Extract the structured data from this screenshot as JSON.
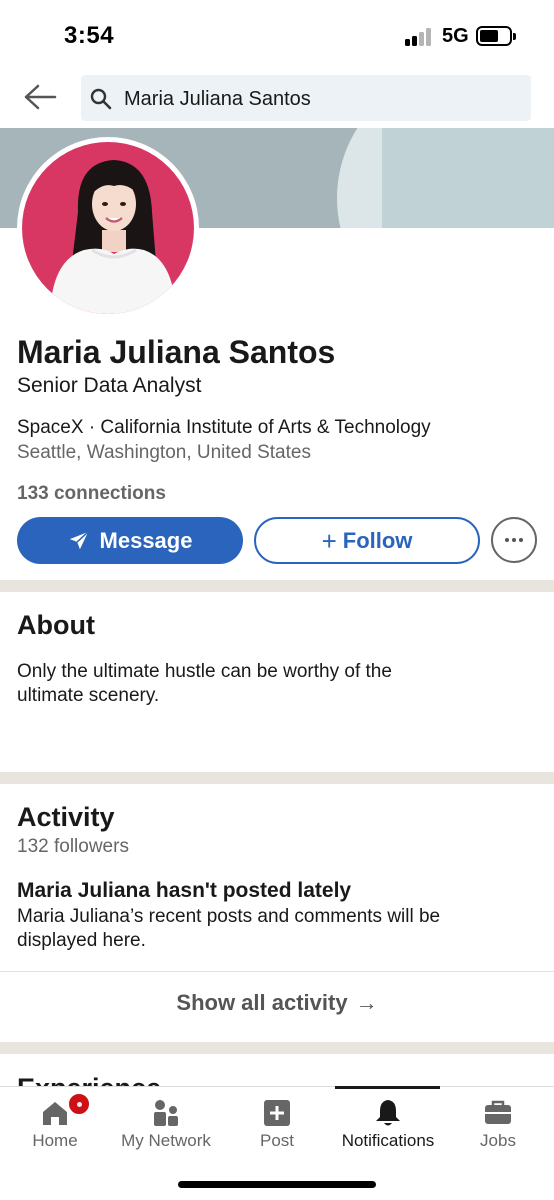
{
  "status_bar": {
    "time": "3:54",
    "network": "5G"
  },
  "search": {
    "query": "Maria Juliana Santos"
  },
  "profile": {
    "name": "Maria Juliana Santos",
    "headline": "Senior Data Analyst",
    "organizations": "SpaceX · California Institute of Arts & Technology",
    "location": "Seattle, Washington, United States",
    "connections": "133 connections",
    "message_label": "Message",
    "follow_label": "Follow",
    "follow_plus": "+"
  },
  "about": {
    "title": "About",
    "text": "Only the ultimate hustle can be worthy of the ultimate scenery."
  },
  "activity": {
    "title": "Activity",
    "followers": "132 followers",
    "heading": "Maria Juliana hasn't posted lately",
    "description": "Maria Juliana’s recent posts and comments will be displayed here.",
    "show_all": "Show all activity",
    "arrow": "→"
  },
  "experience": {
    "title": "Experience"
  },
  "bottom_nav": {
    "items": [
      {
        "label": "Home",
        "icon": "home-icon"
      },
      {
        "label": "My Network",
        "icon": "network-icon"
      },
      {
        "label": "Post",
        "icon": "post-icon"
      },
      {
        "label": "Notifications",
        "icon": "bell-icon"
      },
      {
        "label": "Jobs",
        "icon": "briefcase-icon"
      }
    ],
    "active": "Notifications"
  },
  "colors": {
    "primary": "#2a64bc",
    "badge": "#cc1016",
    "avatar_background": "#d93763"
  }
}
